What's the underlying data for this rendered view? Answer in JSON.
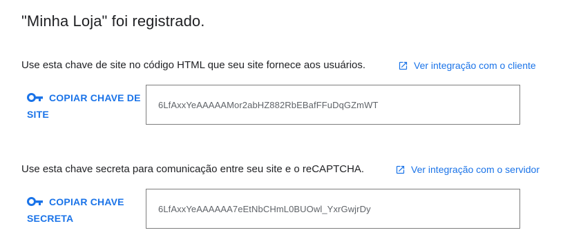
{
  "header": {
    "title": "\"Minha Loja\" foi registrado."
  },
  "site_key_section": {
    "description": "Use esta chave de site no código HTML que seu site fornece aos usuários.",
    "integration_link": "Ver integração com o cliente",
    "copy_button": "COPIAR CHAVE DE SITE",
    "key_value": "6LfAxxYeAAAAAMor2abHZ882RbEBafFFuDqGZmWT"
  },
  "secret_key_section": {
    "description": "Use esta chave secreta para comunicação entre seu site e o reCAPTCHA.",
    "integration_link": "Ver integração com o servidor",
    "copy_button": "COPIAR CHAVE SECRETA",
    "key_value": "6LfAxxYeAAAAAA7eEtNbCHmL0BUOwl_YxrGwjrDy"
  },
  "icons": {
    "external_link": "open-in-new-icon",
    "copy_key": "key-icon"
  },
  "colors": {
    "accent": "#1a73e8",
    "text": "#202124",
    "key_text": "#5f6368",
    "border": "#7d7d7d"
  }
}
